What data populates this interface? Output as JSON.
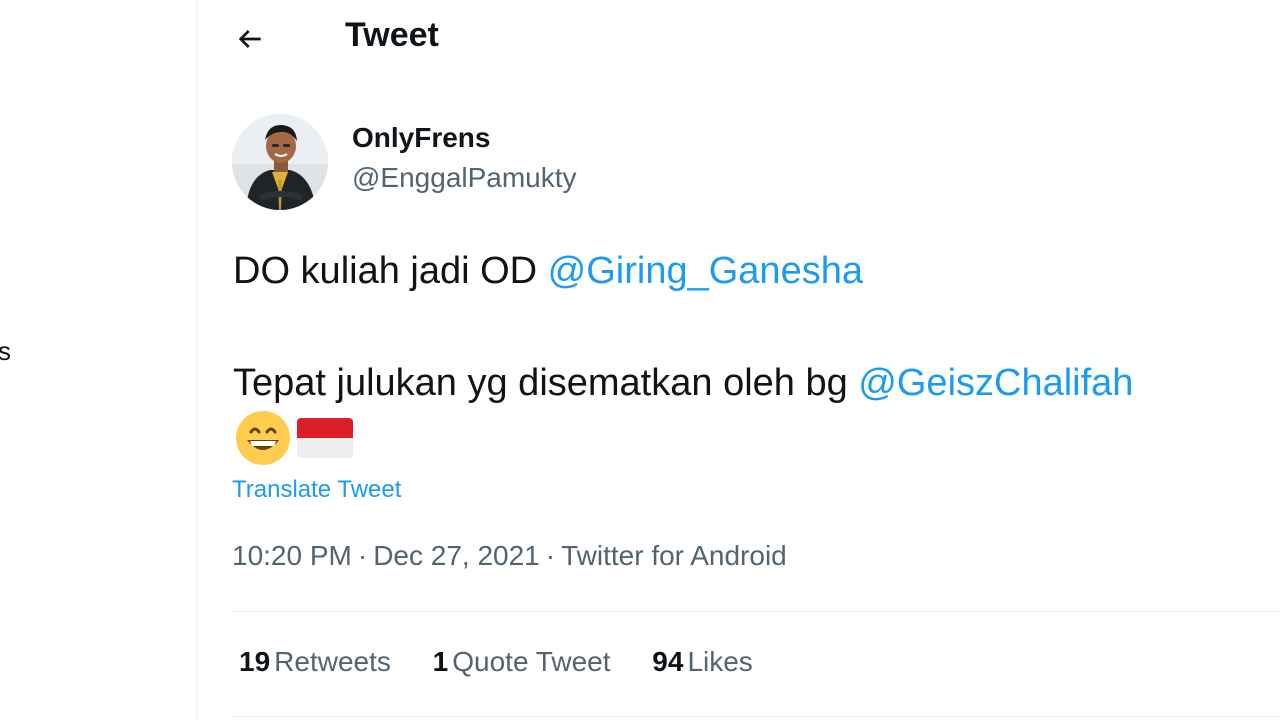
{
  "sidebar": {
    "fragment_text": "s"
  },
  "header": {
    "title": "Tweet",
    "back_icon": "arrow-left-icon"
  },
  "tweet": {
    "author": {
      "display_name": "OnlyFrens",
      "handle": "@EnggalPamukty"
    },
    "text": {
      "line1_text": "DO kuliah jadi OD ",
      "line1_mention": "@Giring_Ganesha",
      "line2_text": "Tepat julukan yg disematkan oleh bg ",
      "line2_mention": "@GeiszChalifah",
      "emojis": [
        "grinning-face-with-smiling-eyes",
        "flag-indonesia"
      ]
    },
    "translate_label": "Translate Tweet",
    "meta": {
      "time": "10:20 PM",
      "separator": "·",
      "date": "Dec 27, 2021",
      "source": "Twitter for Android"
    },
    "stats": {
      "retweets_count": "19",
      "retweets_label": "Retweets",
      "quotes_count": "1",
      "quotes_label": "Quote Tweet",
      "likes_count": "94",
      "likes_label": "Likes"
    }
  },
  "colors": {
    "accent": "#1d9bf0",
    "text_primary": "#0f1419",
    "text_secondary": "#536471",
    "divider": "#eff3f4"
  }
}
